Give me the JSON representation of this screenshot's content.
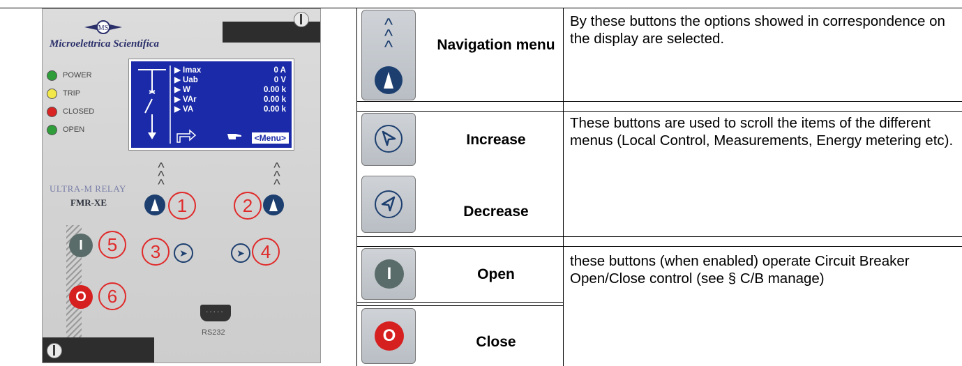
{
  "device": {
    "brand": "Microelettrica Scientifica",
    "logo_text": "MS",
    "leds": [
      {
        "label": "POWER",
        "color": "#2f9e3a"
      },
      {
        "label": "TRIP",
        "color": "#f2e84a"
      },
      {
        "label": "CLOSED",
        "color": "#d92424"
      },
      {
        "label": "OPEN",
        "color": "#2f9e3a"
      }
    ],
    "display": {
      "rows": [
        {
          "name": "▶ Imax",
          "value": "0 A"
        },
        {
          "name": "▶ Uab",
          "value": "0 V"
        },
        {
          "name": "▶ W",
          "value": "0.00 k"
        },
        {
          "name": "▶ VAr",
          "value": "0.00 k"
        },
        {
          "name": "▶ VA",
          "value": "0.00 k"
        }
      ],
      "menu_label": "<Menu>"
    },
    "model_line1": "ULTRA-M RELAY",
    "model_line2": "FMR-XE",
    "numbers": [
      "1",
      "2",
      "3",
      "4",
      "5",
      "6"
    ],
    "open_symbol": "I",
    "close_symbol": "O",
    "port_label": "RS232"
  },
  "table": {
    "rows": [
      {
        "label": "Navigation menu",
        "description": "By these buttons the options showed in correspondence on the display are selected."
      },
      {
        "label": "Increase",
        "description": "These buttons are used to scroll the items of the different menus (Local Control, Measurements, Energy metering etc)."
      },
      {
        "label": "Decrease",
        "description": ""
      },
      {
        "label": "Open",
        "description": "these buttons (when enabled) operate Circuit Breaker Open/Close control (see § C/B manage)"
      },
      {
        "label": "Close",
        "description": ""
      }
    ],
    "icons": {
      "open_symbol": "I",
      "close_symbol": "O"
    }
  },
  "colors": {
    "navy": "#1d3f6f",
    "red": "#e02a2a",
    "display_blue": "#1a2aa8",
    "open_gray": "#5a6c6a",
    "close_red": "#d62020"
  }
}
